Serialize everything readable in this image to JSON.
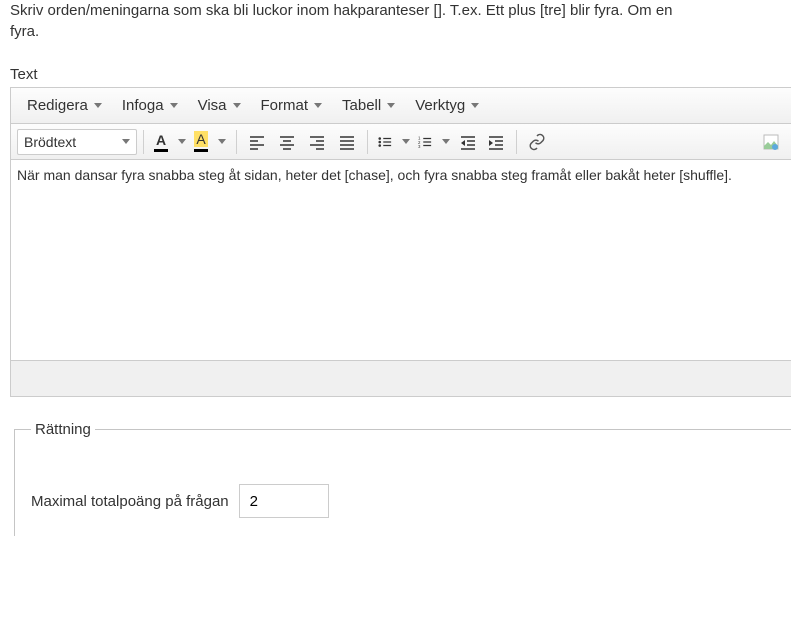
{
  "intro_line1": "Skriv orden/meningarna som ska bli luckor inom hakparanteser []. T.ex. Ett plus [tre] blir fyra. Om en ",
  "intro_line2": "fyra.",
  "label_text": "Text",
  "menubar": {
    "edit": "Redigera",
    "insert": "Infoga",
    "view": "Visa",
    "format": "Format",
    "table": "Tabell",
    "tools": "Verktyg"
  },
  "toolbar": {
    "block_format": "Brödtext",
    "text_color_letter": "A",
    "bg_color_letter": "A"
  },
  "editor_content": "När man dansar fyra snabba steg åt sidan, heter det [chase], och fyra snabba steg framåt eller bakåt heter [shuffle].",
  "fieldset": {
    "legend": "Rättning",
    "max_score_label": "Maximal totalpoäng på frågan",
    "max_score_value": "2"
  }
}
